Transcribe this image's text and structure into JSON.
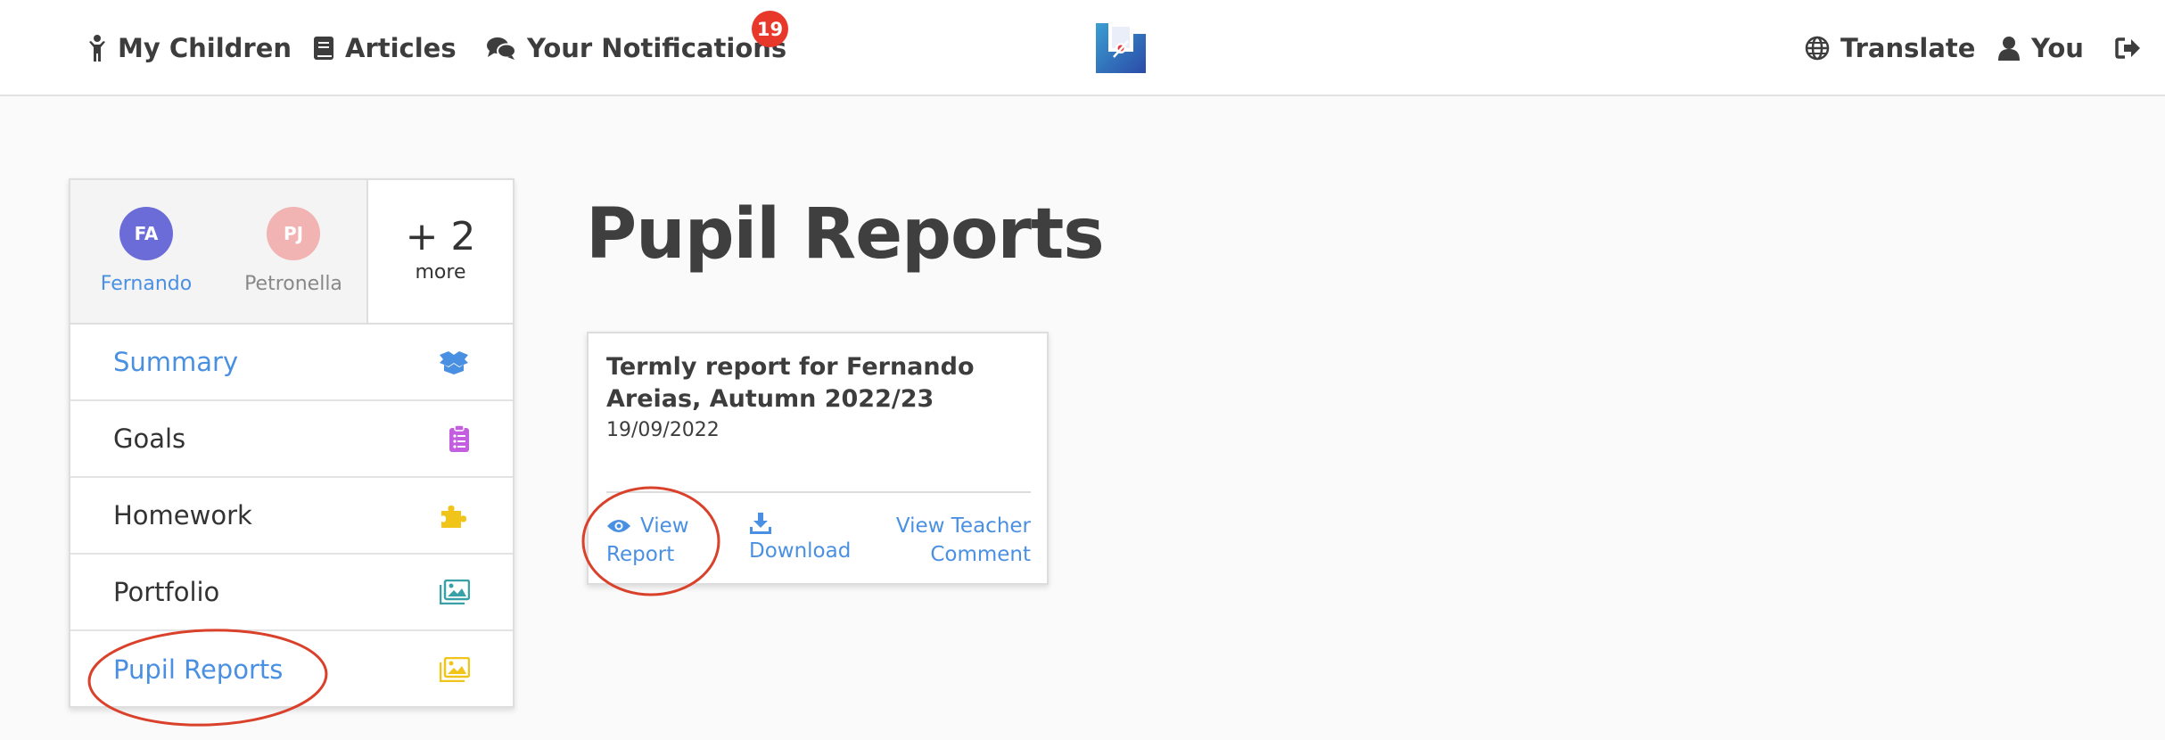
{
  "nav": {
    "my_children": "My Children",
    "articles": "Articles",
    "notifications": "Your Notifications",
    "notification_count": "19",
    "translate": "Translate",
    "you": "You"
  },
  "sidebar": {
    "children": [
      {
        "initials": "FA",
        "name": "Fernando",
        "color": "#6c6cd9"
      },
      {
        "initials": "PJ",
        "name": "Petronella",
        "color": "#f2b3b3"
      }
    ],
    "more_count": "+ 2",
    "more_label": "more",
    "menu": [
      {
        "label": "Summary",
        "icon": "box-open-icon",
        "icon_color": "#4a90e2"
      },
      {
        "label": "Goals",
        "icon": "clipboard-list-icon",
        "icon_color": "#c45ee0"
      },
      {
        "label": "Homework",
        "icon": "puzzle-piece-icon",
        "icon_color": "#f0c419"
      },
      {
        "label": "Portfolio",
        "icon": "image-icon",
        "icon_color": "#3aa0a8"
      },
      {
        "label": "Pupil Reports",
        "icon": "image-icon",
        "icon_color": "#f0c419"
      }
    ]
  },
  "main": {
    "title": "Pupil Reports",
    "report": {
      "title": "Termly report for Fernando Areias, Autumn 2022/23",
      "date": "19/09/2022",
      "actions": {
        "view_report": "View Report",
        "download": "Download",
        "teacher_comment": "View Teacher Comment"
      }
    }
  },
  "colors": {
    "accent": "#4a90e2",
    "badge": "#e8382a",
    "annotation": "#d9412b"
  }
}
